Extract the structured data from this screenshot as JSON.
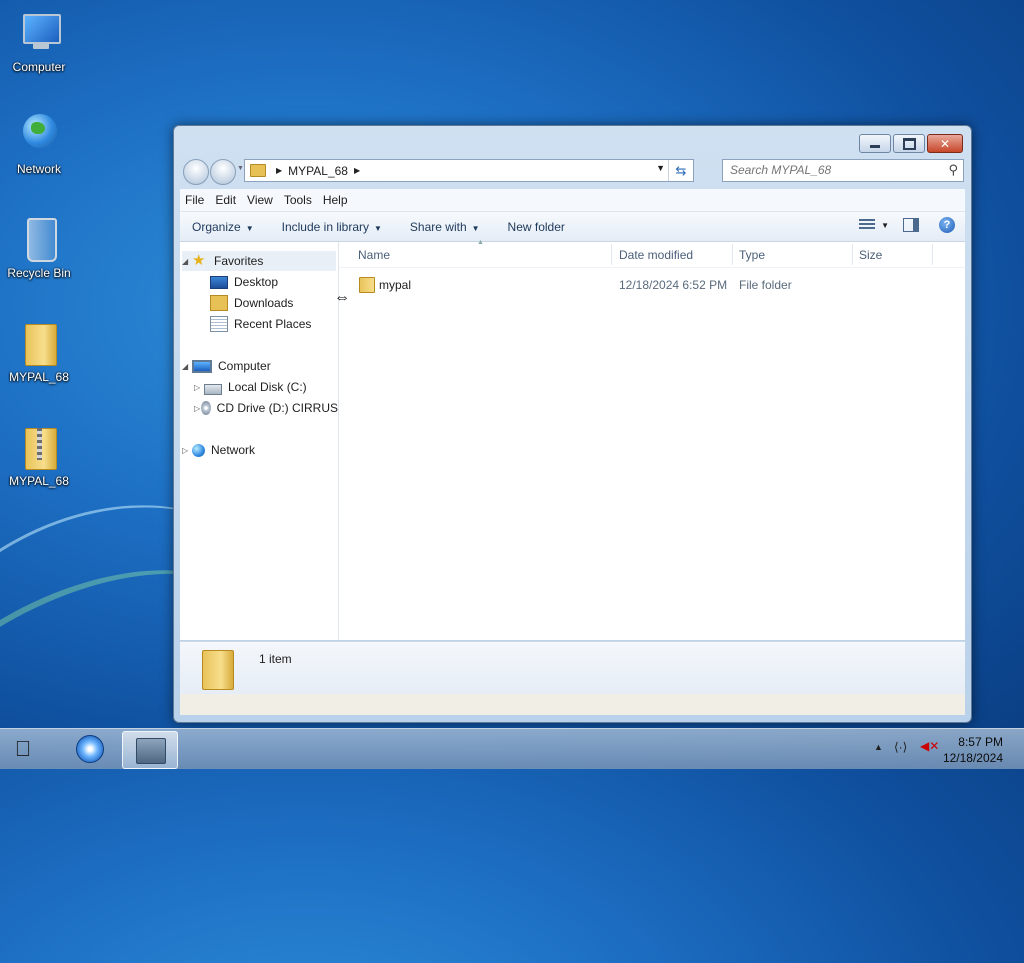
{
  "desktop": {
    "icons": [
      {
        "label": "Computer"
      },
      {
        "label": "Network"
      },
      {
        "label": "Recycle Bin"
      },
      {
        "label": "MYPAL_68"
      },
      {
        "label": "MYPAL_68"
      }
    ]
  },
  "window": {
    "address": {
      "folder": "MYPAL_68"
    },
    "search": {
      "placeholder": "Search MYPAL_68"
    },
    "menu": [
      "File",
      "Edit",
      "View",
      "Tools",
      "Help"
    ],
    "toolbar": {
      "organize": "Organize",
      "include_in_library": "Include in library",
      "share_with": "Share with",
      "new_folder": "New folder"
    },
    "nav": {
      "favorites": "Favorites",
      "desktop": "Desktop",
      "downloads": "Downloads",
      "recent_places": "Recent Places",
      "computer": "Computer",
      "local_disk": "Local Disk (C:)",
      "cd_drive": "CD Drive (D:) CIRRUS",
      "network": "Network"
    },
    "columns": [
      "Name",
      "Date modified",
      "Type",
      "Size"
    ],
    "files": [
      {
        "name": "mypal",
        "date_modified": "12/18/2024 6:52 PM",
        "type": "File folder",
        "size": ""
      }
    ],
    "details": {
      "count": "1 item"
    }
  },
  "taskbar": {
    "clock": {
      "time": "8:57 PM",
      "date": "12/18/2024"
    }
  },
  "colors": {
    "accent": "#1d6fc4",
    "window_frame": "#b9d1ea",
    "close_button": "#c7472a"
  }
}
